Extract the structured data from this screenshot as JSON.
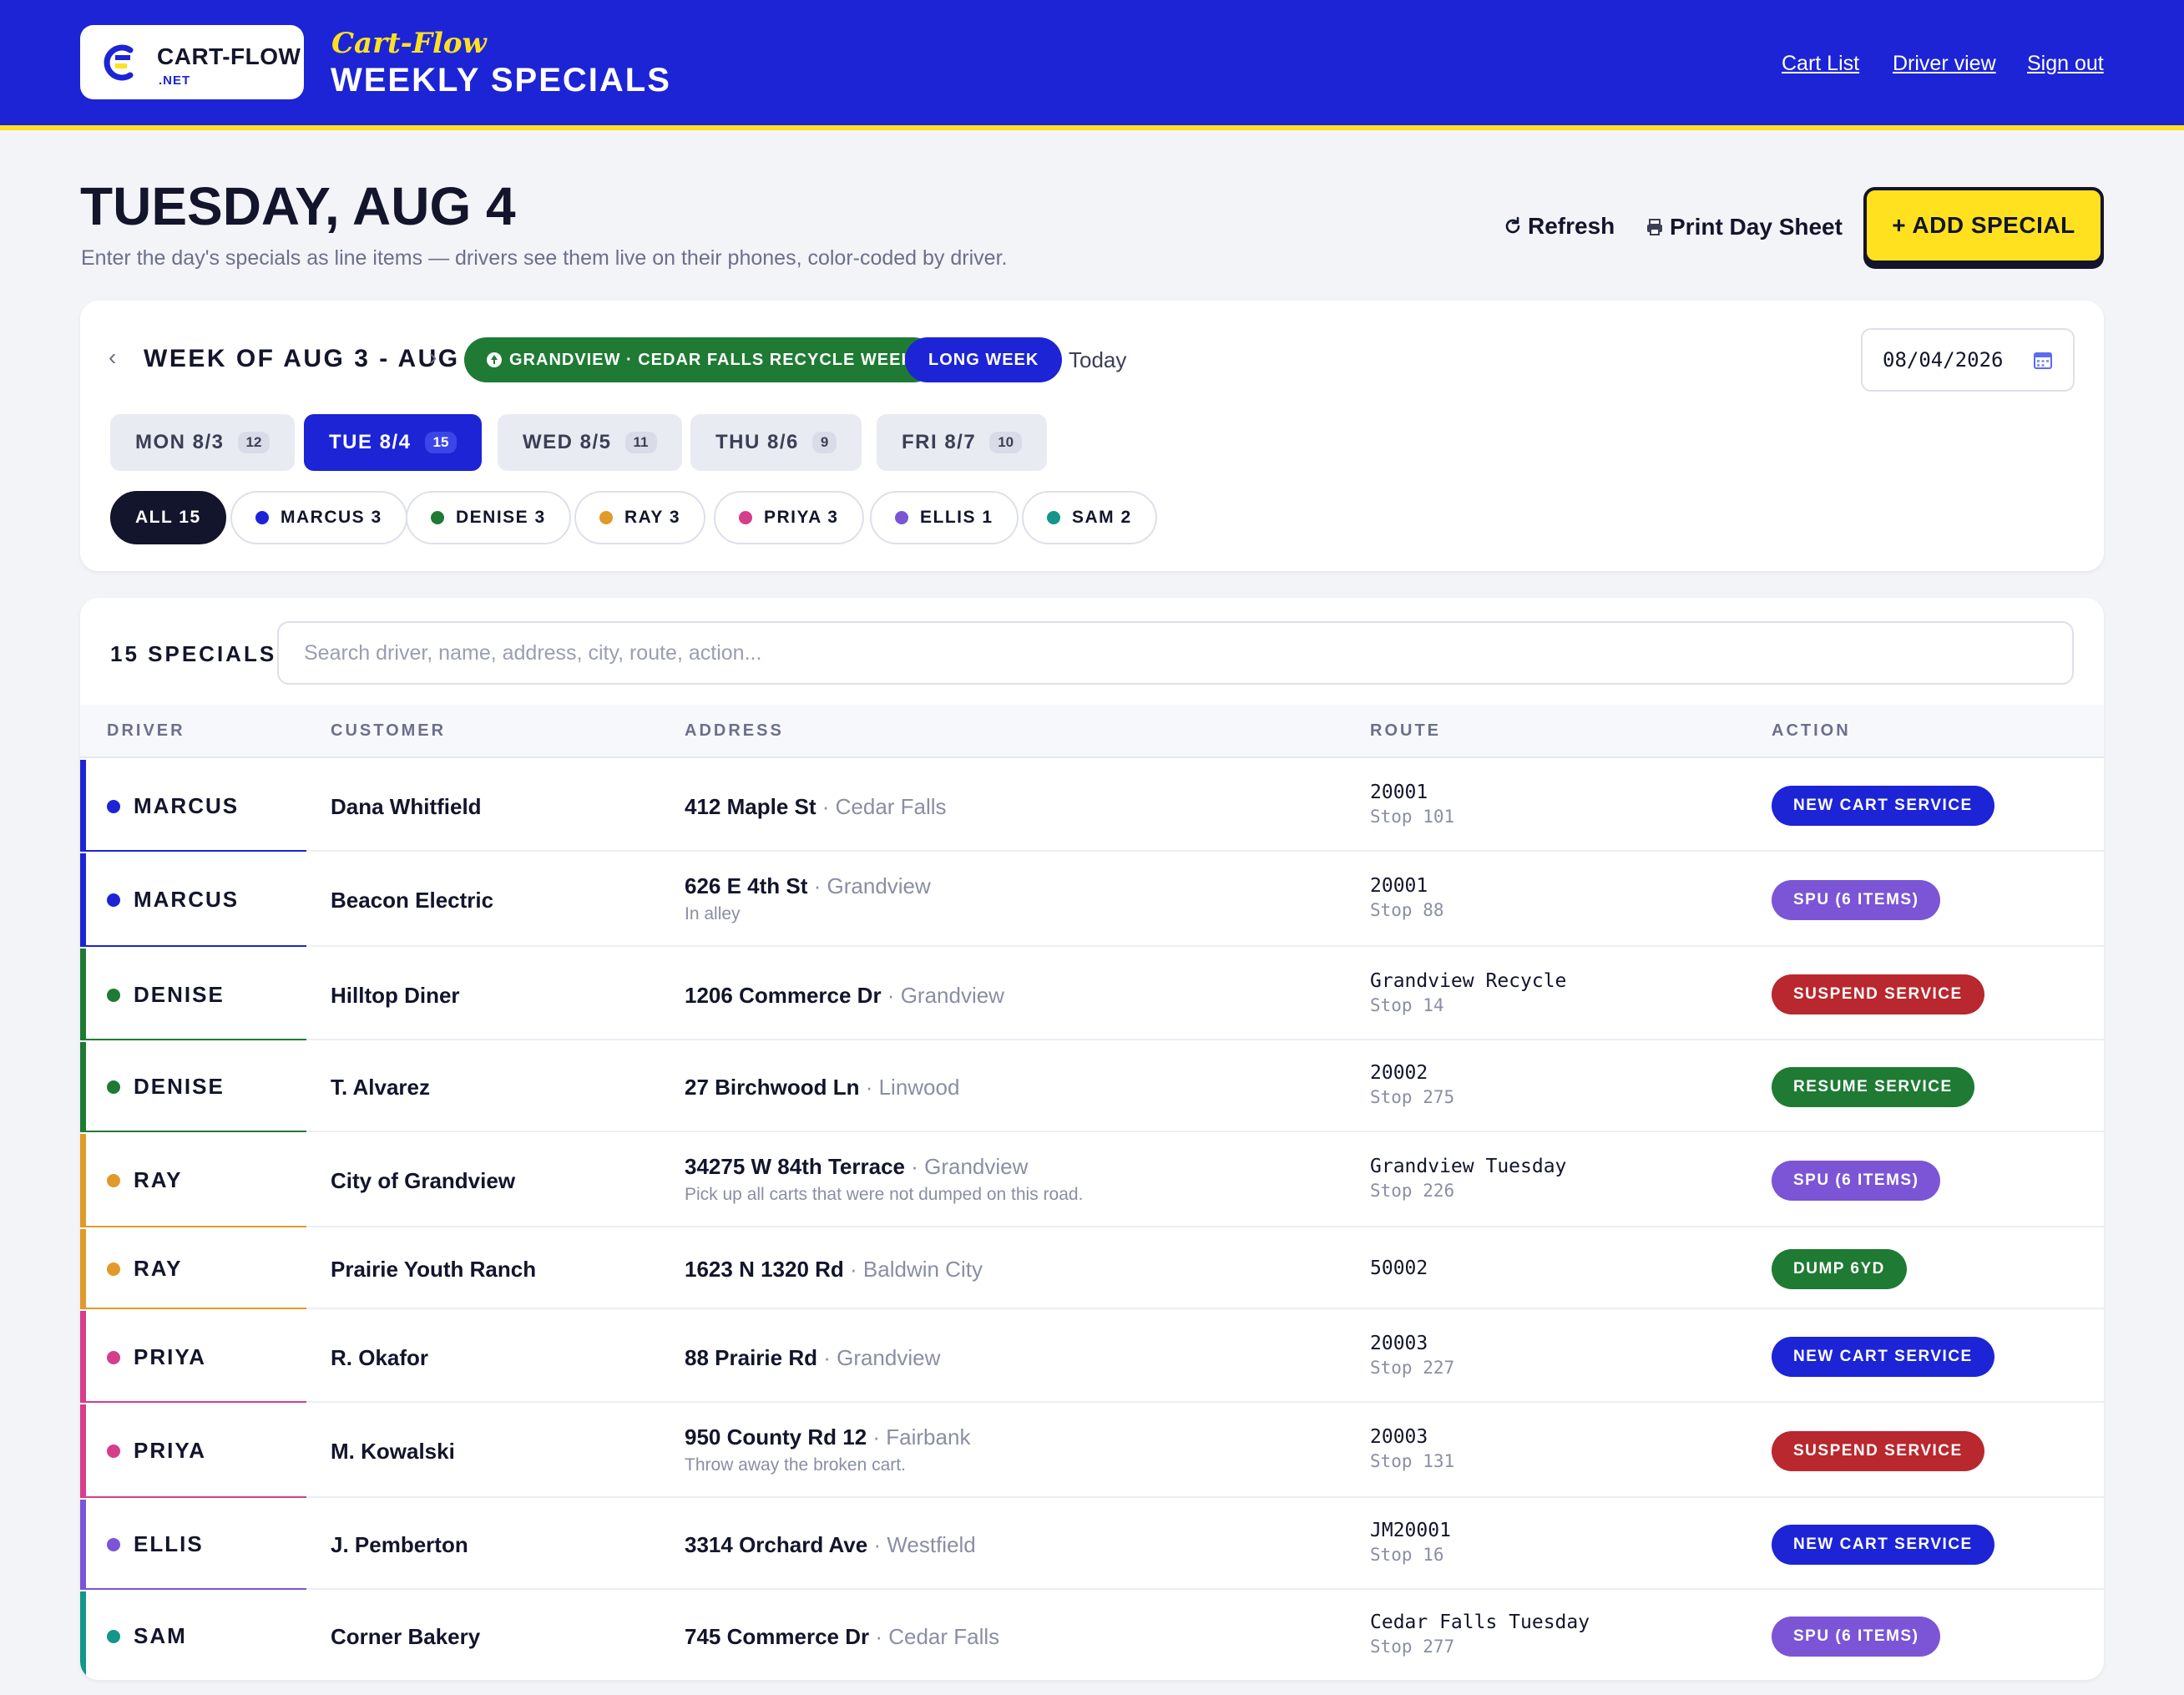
{
  "header": {
    "logo_name": "CART-FLOW",
    "logo_sub": ".NET",
    "brand_script": "Cart-Flow",
    "brand_title": "WEEKLY SPECIALS",
    "nav": [
      "Cart List",
      "Driver view",
      "Sign out"
    ]
  },
  "page": {
    "title": "TUESDAY, AUG 4",
    "subtitle": "Enter the day's specials as line items — drivers see them live on their phones, color-coded by driver.",
    "refresh_label": "Refresh",
    "print_label": "Print Day Sheet",
    "add_label": "+ ADD SPECIAL"
  },
  "filters": {
    "week_label": "WEEK OF AUG 3 - AUG 7",
    "recycle_label": "GRANDVIEW · CEDAR FALLS RECYCLE WEEK",
    "long_week_label": "LONG WEEK",
    "today_label": "Today",
    "date_value": "08/04/2026",
    "days": [
      {
        "label": "MON 8/3",
        "count": "12"
      },
      {
        "label": "TUE 8/4",
        "count": "15"
      },
      {
        "label": "WED 8/5",
        "count": "11"
      },
      {
        "label": "THU 8/6",
        "count": "9"
      },
      {
        "label": "FRI 8/7",
        "count": "10"
      }
    ],
    "drivers": [
      {
        "label": "ALL 15"
      },
      {
        "label": "MARCUS 3",
        "color": "#1c24d6"
      },
      {
        "label": "DENISE 3",
        "color": "#1f7a34"
      },
      {
        "label": "RAY 3",
        "color": "#e09a2a"
      },
      {
        "label": "PRIYA 3",
        "color": "#d63d8a"
      },
      {
        "label": "ELLIS 1",
        "color": "#7b55d6"
      },
      {
        "label": "SAM 2",
        "color": "#14968a"
      }
    ]
  },
  "list": {
    "count_label": "15 SPECIALS",
    "search_placeholder": "Search driver, name, address, city, route, action...",
    "columns": [
      "DRIVER",
      "CUSTOMER",
      "ADDRESS",
      "ROUTE",
      "ACTION"
    ],
    "rows": [
      {
        "driver": "MARCUS",
        "customer": "Dana Whitfield",
        "street": "412 Maple St",
        "city": "Cedar Falls",
        "note": "",
        "route": "20001",
        "stop": "Stop 101",
        "action": "NEW CART SERVICE"
      },
      {
        "driver": "MARCUS",
        "customer": "Beacon Electric",
        "street": "626 E 4th St",
        "city": "Grandview",
        "note": "In alley",
        "route": "20001",
        "stop": "Stop 88",
        "action": "SPU (6 ITEMS)"
      },
      {
        "driver": "DENISE",
        "customer": "Hilltop Diner",
        "street": "1206 Commerce Dr",
        "city": "Grandview",
        "note": "",
        "route": "Grandview Recycle",
        "stop": "Stop 14",
        "action": "SUSPEND SERVICE"
      },
      {
        "driver": "DENISE",
        "customer": "T. Alvarez",
        "street": "27 Birchwood Ln",
        "city": "Linwood",
        "note": "",
        "route": "20002",
        "stop": "Stop 275",
        "action": "RESUME SERVICE"
      },
      {
        "driver": "RAY",
        "customer": "City of Grandview",
        "street": "34275 W 84th Terrace",
        "city": "Grandview",
        "note": "Pick up all carts that were not dumped on this road.",
        "route": "Grandview Tuesday",
        "stop": "Stop 226",
        "action": "SPU (6 ITEMS)"
      },
      {
        "driver": "RAY",
        "customer": "Prairie Youth Ranch",
        "street": "1623 N 1320 Rd",
        "city": "Baldwin City",
        "note": "",
        "route": "50002",
        "stop": "",
        "action": "DUMP 6YD"
      },
      {
        "driver": "PRIYA",
        "customer": "R. Okafor",
        "street": "88 Prairie Rd",
        "city": "Grandview",
        "note": "",
        "route": "20003",
        "stop": "Stop 227",
        "action": "NEW CART SERVICE"
      },
      {
        "driver": "PRIYA",
        "customer": "M. Kowalski",
        "street": "950 County Rd 12",
        "city": "Fairbank",
        "note": "Throw away the broken cart.",
        "route": "20003",
        "stop": "Stop 131",
        "action": "SUSPEND SERVICE"
      },
      {
        "driver": "ELLIS",
        "customer": "J. Pemberton",
        "street": "3314 Orchard Ave",
        "city": "Westfield",
        "note": "",
        "route": "JM20001",
        "stop": "Stop 16",
        "action": "NEW CART SERVICE"
      },
      {
        "driver": "SAM",
        "customer": "Corner Bakery",
        "street": "745 Commerce Dr",
        "city": "Cedar Falls",
        "note": "",
        "route": "Cedar Falls Tuesday",
        "stop": "Stop 277",
        "action": "SPU (6 ITEMS)"
      }
    ]
  },
  "colors": {
    "brand": "#1c24d6",
    "accent": "#ffe11f",
    "marcus": "#1c24d6",
    "denise": "#1f7a34",
    "ray": "#e09a2a",
    "priya": "#d63d8a",
    "ellis": "#7b55d6",
    "sam": "#14968a",
    "action_new": "#1c24d6",
    "action_spu": "#7b55d6",
    "action_suspend": "#b8282e",
    "action_green": "#1f7a34"
  }
}
